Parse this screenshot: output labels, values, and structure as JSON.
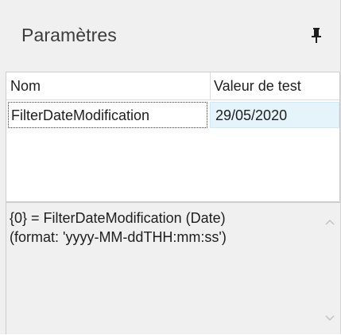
{
  "panel": {
    "title": "Paramètres",
    "pin_icon": "pin-icon"
  },
  "table": {
    "columns": [
      "Nom",
      "Valeur de test"
    ],
    "rows": [
      {
        "name": "FilterDateModification",
        "value": "29/05/2020"
      }
    ]
  },
  "description": {
    "lines": [
      "{0} = FilterDateModification (Date)",
      "(format: 'yyyy-MM-ddTHH:mm:ss')"
    ],
    "scroll_up_icon": "chevron-up-icon",
    "scroll_down_icon": "chevron-down-icon"
  },
  "colors": {
    "panel_background": "#f0f0f0",
    "selected_cell": "#e5f3fb",
    "text": "#1e1e1e"
  }
}
